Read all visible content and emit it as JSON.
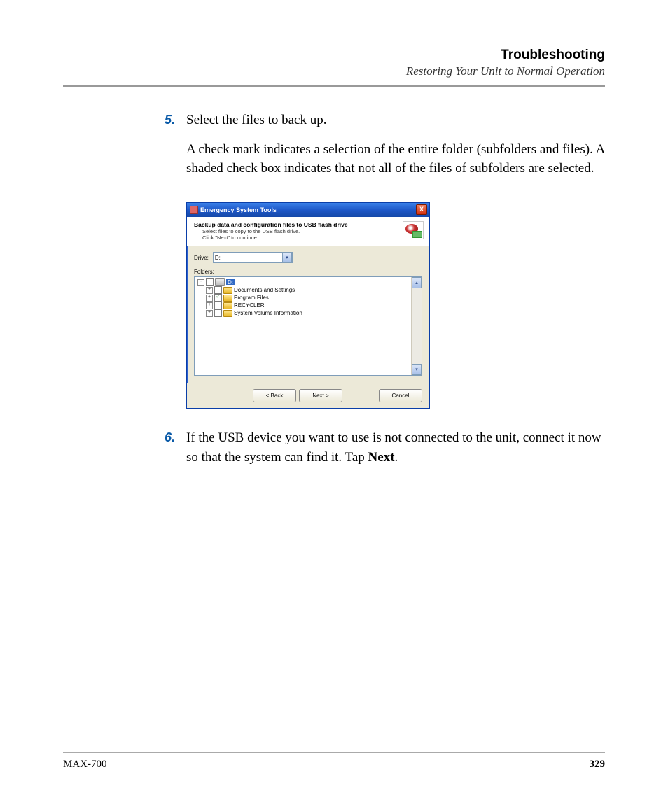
{
  "header": {
    "title": "Troubleshooting",
    "subtitle": "Restoring Your Unit to Normal Operation"
  },
  "steps": {
    "s5": {
      "num": "5.",
      "line1": "Select the files to back up.",
      "line2": "A check mark indicates a selection of the entire folder (subfolders and files). A shaded check box indicates that not all of the files of subfolders are selected."
    },
    "s6": {
      "num": "6.",
      "text_a": "If the USB device you want to use is not connected to the unit, connect it now so that the system can find it. Tap ",
      "text_bold": "Next",
      "text_b": "."
    }
  },
  "dialog": {
    "title": "Emergency System Tools",
    "close_x": "X",
    "heading": "Backup data and configuration files to USB flash drive",
    "sub1": "Select files to copy to the USB flash drive.",
    "sub2": "Click \"Next\" to continue.",
    "drive_label": "Drive:",
    "drive_value": "D:",
    "folders_label": "Folders:",
    "tree": {
      "root": {
        "exp": "-",
        "label": "D:"
      },
      "items": [
        {
          "exp": "+",
          "checked": false,
          "label": "Documents and Settings"
        },
        {
          "exp": "+",
          "checked": true,
          "label": "Program Files"
        },
        {
          "exp": "+",
          "checked": false,
          "label": "RECYCLER"
        },
        {
          "exp": "+",
          "checked": false,
          "label": "System Volume Information"
        }
      ]
    },
    "buttons": {
      "back": "< Back",
      "next": "Next >",
      "cancel": "Cancel"
    }
  },
  "footer": {
    "left": "MAX-700",
    "right": "329"
  }
}
